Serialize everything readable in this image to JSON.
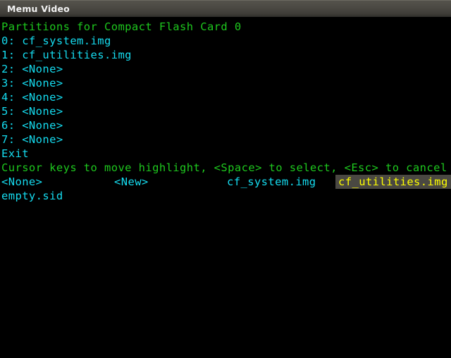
{
  "window": {
    "title": "Memu Video"
  },
  "terminal": {
    "header": "Partitions for Compact Flash Card 0",
    "partitions": [
      {
        "text": "0: cf_system.img"
      },
      {
        "text": "1: cf_utilities.img"
      },
      {
        "text": "2: <None>"
      },
      {
        "text": "3: <None>"
      },
      {
        "text": "4: <None>"
      },
      {
        "text": "5: <None>"
      },
      {
        "text": "6: <None>"
      },
      {
        "text": "7: <None>"
      }
    ],
    "exit_label": "Exit",
    "instructions": "Cursor keys to move highlight, <Space> to select, <Esc> to cancel",
    "choices": [
      {
        "label": "<None>",
        "selected": false
      },
      {
        "label": "<New>",
        "selected": false
      },
      {
        "label": "cf_system.img",
        "selected": false
      },
      {
        "label": "cf_utilities.img",
        "selected": true
      }
    ],
    "extra_file": "empty.sid"
  },
  "colors": {
    "header_green": "#1ec81e",
    "list_cyan": "#15dcf0",
    "highlight_text": "#ffff00",
    "highlight_bg": "#4a4842",
    "terminal_bg": "#000000",
    "titlebar_text": "#f2f2f2"
  }
}
